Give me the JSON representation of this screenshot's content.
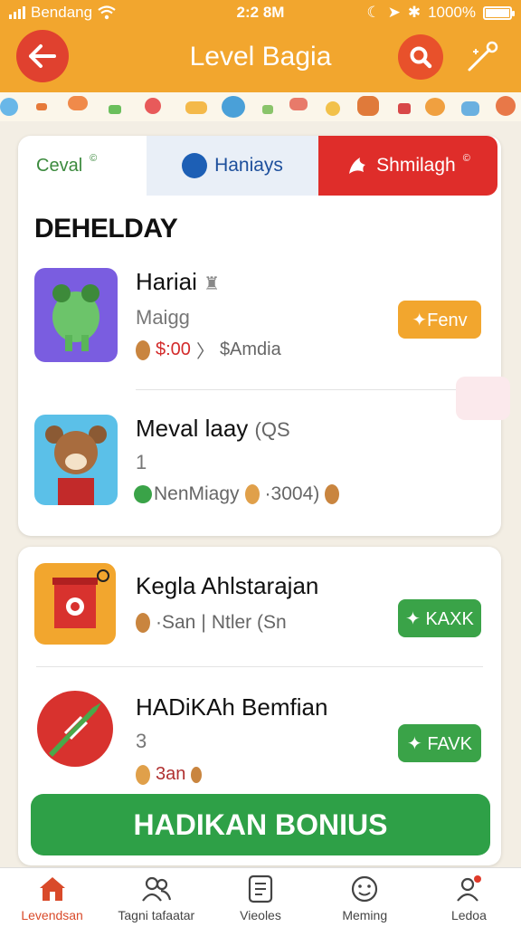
{
  "status_bar": {
    "carrier": "Bendang",
    "time": "2:2 8M",
    "battery_text": "1000%",
    "battery_level": 1.0
  },
  "header": {
    "title": "Level Bagia"
  },
  "colors": {
    "header_bg": "#f2a62e",
    "accent_red": "#df2d2a",
    "accent_green": "#2ea047",
    "tab_blue": "#1d4f9c"
  },
  "tabs": [
    {
      "label": "Ceval",
      "mark": "©",
      "icon": ""
    },
    {
      "label": "Haniays",
      "mark": "",
      "icon": "globe-icon"
    },
    {
      "label": "Shmilagh",
      "mark": "©",
      "icon": "flame-icon"
    }
  ],
  "section_title": "DEHELDAY",
  "items": [
    {
      "title": "Hariai",
      "subtitle": "Maigg",
      "price": "$:00",
      "sep": "〉",
      "meta": "$Amdia",
      "button": "✦Fenv",
      "icon": "frog-icon"
    },
    {
      "title": "Meval laay",
      "title_suffix": "(QS",
      "subtitle": "1",
      "meta": "NenMiagy",
      "meta2": "·3004)",
      "icon": "bear-icon"
    },
    {
      "title": "Kegla Ahlstarajan",
      "subtitle": "",
      "meta": "·San",
      "sep": "|",
      "meta2": "Ntler (Sn",
      "button": "✦ KAXK",
      "icon": "shop-icon"
    },
    {
      "title": "HADiKAh Bemfian",
      "subtitle": "3",
      "meta": "3an",
      "button": "✦ FAVK",
      "icon": "rocket-icon"
    }
  ],
  "bonus_button": "HADIKAN BONIUS",
  "bottom_nav": [
    {
      "label": "Levendsan",
      "icon": "home-icon",
      "active": true
    },
    {
      "label": "Tagni tafaatar",
      "icon": "people-icon",
      "active": false
    },
    {
      "label": "Vieoles",
      "icon": "document-icon",
      "active": false
    },
    {
      "label": "Meming",
      "icon": "smiley-icon",
      "active": false
    },
    {
      "label": "Ledoa",
      "icon": "profile-icon",
      "active": false
    }
  ]
}
